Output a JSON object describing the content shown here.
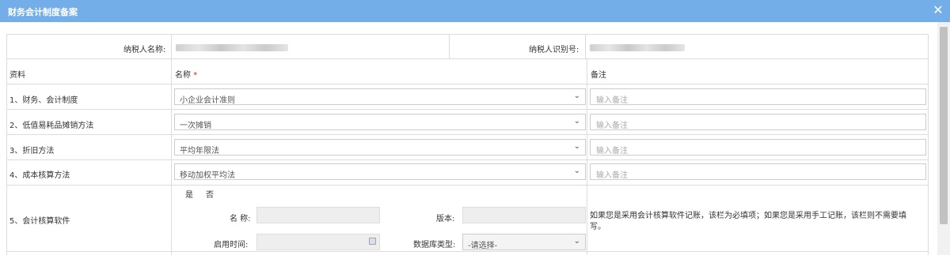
{
  "dialog": {
    "title": "财务会计制度备案",
    "close_icon": "close-icon"
  },
  "taxpayer": {
    "name_label": "纳税人名称:",
    "id_label": "纳税人识别号:"
  },
  "headers": {
    "material": "资料",
    "name": "名称",
    "required_mark": "*",
    "remark": "备注"
  },
  "rows": [
    {
      "label": "1、财务、会计制度",
      "value": "小企业会计准则",
      "remark_placeholder": "输入备注"
    },
    {
      "label": "2、低值易耗品摊销方法",
      "value": "一次摊销",
      "remark_placeholder": "输入备注"
    },
    {
      "label": "3、折旧方法",
      "value": "平均年限法",
      "remark_placeholder": "输入备注"
    },
    {
      "label": "4、成本核算方法",
      "value": "移动加权平均法",
      "remark_placeholder": "输入备注"
    }
  ],
  "software": {
    "label": "5、会计核算软件",
    "yes": "是",
    "no": "否",
    "name_label": "名 称:",
    "version_label": "版本:",
    "start_label": "启用时间:",
    "db_label": "数据库类型:",
    "db_value": "-请选择-",
    "note": "如果您是采用会计核算软件记账，该栏为必填项；如果您是采用手工记账，该栏则不需要填",
    "note2": "写。"
  }
}
